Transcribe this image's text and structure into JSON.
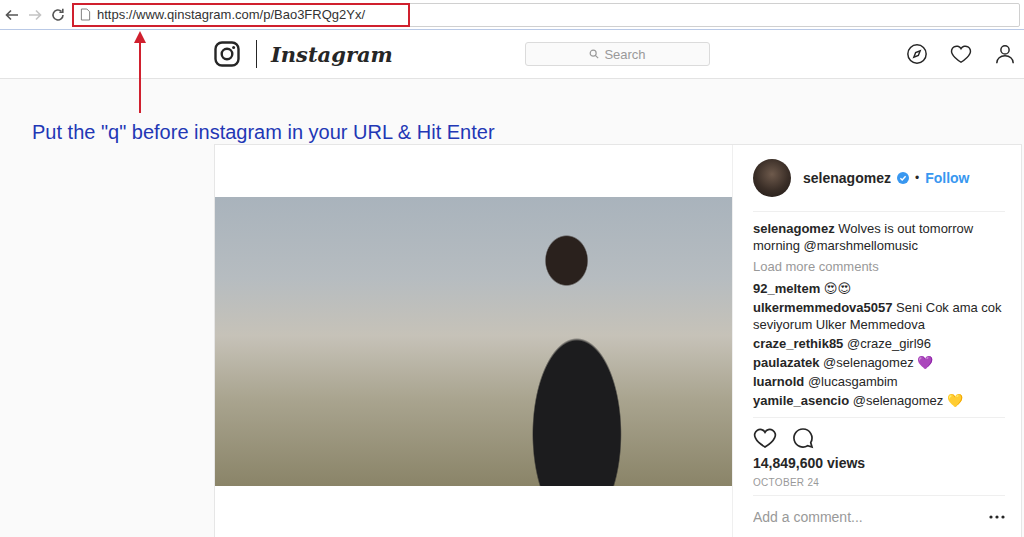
{
  "browser": {
    "url": "https://www.qinstagram.com/p/Bao3FRQg2Yx/"
  },
  "header": {
    "logo_text": "Instagram",
    "search": {
      "placeholder": "Search"
    }
  },
  "annotation": {
    "text": "Put the \"q\" before instagram in your URL & Hit Enter"
  },
  "post": {
    "author": "selenagomez",
    "verified": true,
    "follow_separator": "•",
    "follow": "Follow",
    "caption": {
      "user": "selenagomez",
      "text": "Wolves is out tomorrow morning @marshmellomusic"
    },
    "load_more": "Load more comments",
    "comments": [
      {
        "user": "92_meltem",
        "text": "😍😍"
      },
      {
        "user": "ulkermemmedova5057",
        "text": "Seni Cok ama cok seviyorum Ulker Memmedova"
      },
      {
        "user": "craze_rethik85",
        "text": "@craze_girl96"
      },
      {
        "user": "paulazatek",
        "text": "@selenagomez 💜"
      },
      {
        "user": "luarnold",
        "text": "@lucasgambim"
      },
      {
        "user": "yamile_asencio",
        "text": "@selenagomez 💛"
      }
    ],
    "views": "14,849,600 views",
    "date": "OCTOBER 24",
    "add_comment_placeholder": "Add a comment..."
  }
}
